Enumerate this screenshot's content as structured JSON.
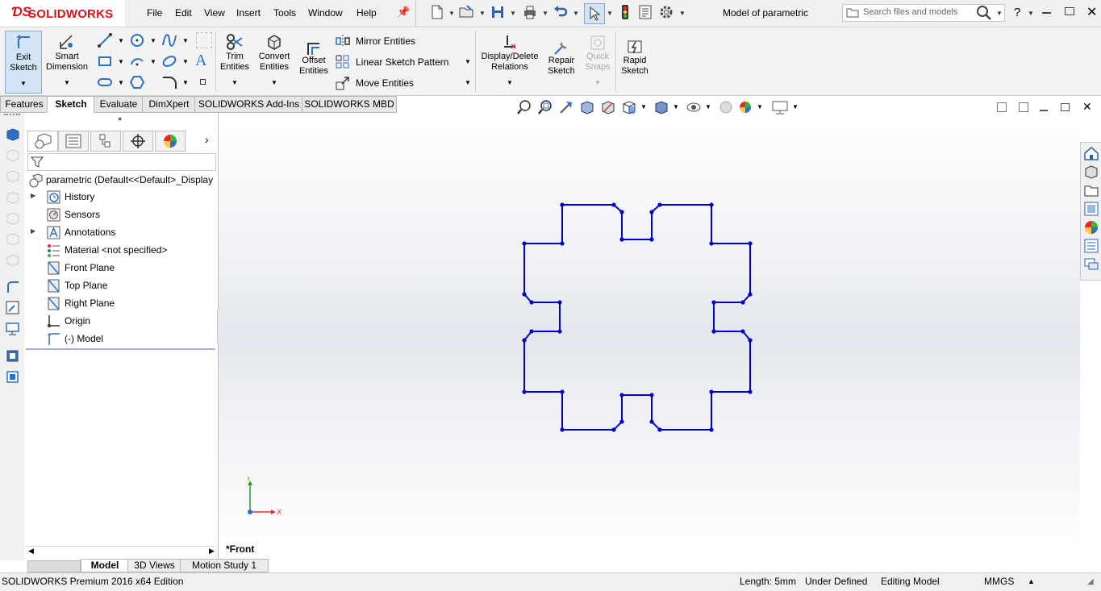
{
  "app": {
    "logo_text": "SOLIDWORKS",
    "window_title": "Model of parametric",
    "menu": [
      "File",
      "Edit",
      "View",
      "Insert",
      "Tools",
      "Window",
      "Help"
    ],
    "search_placeholder": "Search files and models",
    "help_label": "?"
  },
  "ribbon": {
    "exit_sketch": "Exit Sketch",
    "smart_dimension": "Smart Dimension",
    "trim_entities": "Trim Entities",
    "convert_entities": "Convert Entities",
    "offset_entities": "Offset Entities",
    "mirror_entities": "Mirror Entities",
    "linear_sketch_pattern": "Linear Sketch Pattern",
    "move_entities": "Move Entities",
    "display_delete_relations": "Display/Delete Relations",
    "repair_sketch": "Repair Sketch",
    "quick_snaps": "Quick Snaps",
    "rapid_sketch": "Rapid Sketch"
  },
  "command_tabs": [
    "Features",
    "Sketch",
    "Evaluate",
    "DimXpert",
    "SOLIDWORKS Add-Ins",
    "SOLIDWORKS MBD"
  ],
  "active_command_tab": "Sketch",
  "feature_tree": {
    "root": "parametric  (Default<<Default>_Display",
    "items": [
      {
        "label": "History",
        "icon": "history-icon",
        "expandable": true
      },
      {
        "label": "Sensors",
        "icon": "sensors-icon",
        "expandable": false
      },
      {
        "label": "Annotations",
        "icon": "annotations-icon",
        "expandable": true
      },
      {
        "label": "Material <not specified>",
        "icon": "material-icon",
        "expandable": false
      },
      {
        "label": "Front Plane",
        "icon": "plane-icon",
        "expandable": false
      },
      {
        "label": "Top Plane",
        "icon": "plane-icon",
        "expandable": false
      },
      {
        "label": "Right Plane",
        "icon": "plane-icon",
        "expandable": false
      },
      {
        "label": "Origin",
        "icon": "origin-icon",
        "expandable": false
      },
      {
        "label": "(-) Model",
        "icon": "sketch-icon",
        "expandable": false
      }
    ]
  },
  "graphics": {
    "view_label": "*Front",
    "triad_x": "X",
    "triad_y": "Y",
    "sketch_color": "#0000cc"
  },
  "bottom_tabs": [
    "Model",
    "3D Views",
    "Motion Study 1"
  ],
  "active_bottom_tab": "Model",
  "status": {
    "edition": "SOLIDWORKS Premium 2016 x64 Edition",
    "length": "Length: 5mm",
    "definition": "Under Defined",
    "mode": "Editing Model",
    "units": "MMGS"
  }
}
